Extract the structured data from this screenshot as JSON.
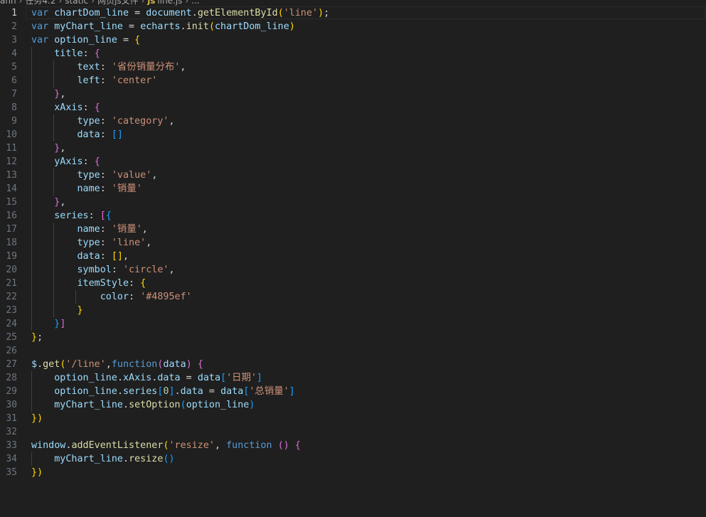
{
  "breadcrumb": {
    "items": [
      "ann",
      "任务4.2",
      "static",
      "网页js文件",
      "line.js",
      "..."
    ]
  },
  "editor": {
    "active_line": 1,
    "lines": [
      [
        [
          "kw",
          "var"
        ],
        [
          "pc",
          " "
        ],
        [
          "vr",
          "chartDom_line"
        ],
        [
          "pc",
          " = "
        ],
        [
          "vr",
          "document"
        ],
        [
          "pc",
          "."
        ],
        [
          "fn",
          "getElementById"
        ],
        [
          "b1",
          "("
        ],
        [
          "st",
          "'line'"
        ],
        [
          "b1",
          ")"
        ],
        [
          "pc",
          ";"
        ]
      ],
      [
        [
          "kw",
          "var"
        ],
        [
          "pc",
          " "
        ],
        [
          "vr",
          "myChart_line"
        ],
        [
          "pc",
          " = "
        ],
        [
          "vr",
          "echarts"
        ],
        [
          "pc",
          "."
        ],
        [
          "fn",
          "init"
        ],
        [
          "b1",
          "("
        ],
        [
          "vr",
          "chartDom_line"
        ],
        [
          "b1",
          ")"
        ]
      ],
      [
        [
          "kw",
          "var"
        ],
        [
          "pc",
          " "
        ],
        [
          "vr",
          "option_line"
        ],
        [
          "pc",
          " = "
        ],
        [
          "b1",
          "{"
        ]
      ],
      [
        [
          "pc",
          "    "
        ],
        [
          "vr",
          "title"
        ],
        [
          "pc",
          ": "
        ],
        [
          "b2",
          "{"
        ]
      ],
      [
        [
          "pc",
          "        "
        ],
        [
          "vr",
          "text"
        ],
        [
          "pc",
          ": "
        ],
        [
          "st",
          "'省份销量分布'"
        ],
        [
          "pc",
          ","
        ]
      ],
      [
        [
          "pc",
          "        "
        ],
        [
          "vr",
          "left"
        ],
        [
          "pc",
          ": "
        ],
        [
          "st",
          "'center'"
        ]
      ],
      [
        [
          "pc",
          "    "
        ],
        [
          "b2",
          "}"
        ],
        [
          "pc",
          ","
        ]
      ],
      [
        [
          "pc",
          "    "
        ],
        [
          "vr",
          "xAxis"
        ],
        [
          "pc",
          ": "
        ],
        [
          "b2",
          "{"
        ]
      ],
      [
        [
          "pc",
          "        "
        ],
        [
          "vr",
          "type"
        ],
        [
          "pc",
          ": "
        ],
        [
          "st",
          "'category'"
        ],
        [
          "pc",
          ","
        ]
      ],
      [
        [
          "pc",
          "        "
        ],
        [
          "vr",
          "data"
        ],
        [
          "pc",
          ": "
        ],
        [
          "b3",
          "[]"
        ]
      ],
      [
        [
          "pc",
          "    "
        ],
        [
          "b2",
          "}"
        ],
        [
          "pc",
          ","
        ]
      ],
      [
        [
          "pc",
          "    "
        ],
        [
          "vr",
          "yAxis"
        ],
        [
          "pc",
          ": "
        ],
        [
          "b2",
          "{"
        ]
      ],
      [
        [
          "pc",
          "        "
        ],
        [
          "vr",
          "type"
        ],
        [
          "pc",
          ": "
        ],
        [
          "st",
          "'value'"
        ],
        [
          "pc",
          ","
        ]
      ],
      [
        [
          "pc",
          "        "
        ],
        [
          "vr",
          "name"
        ],
        [
          "pc",
          ": "
        ],
        [
          "st",
          "'销量'"
        ]
      ],
      [
        [
          "pc",
          "    "
        ],
        [
          "b2",
          "}"
        ],
        [
          "pc",
          ","
        ]
      ],
      [
        [
          "pc",
          "    "
        ],
        [
          "vr",
          "series"
        ],
        [
          "pc",
          ": "
        ],
        [
          "b2",
          "["
        ],
        [
          "b3",
          "{"
        ]
      ],
      [
        [
          "pc",
          "        "
        ],
        [
          "vr",
          "name"
        ],
        [
          "pc",
          ": "
        ],
        [
          "st",
          "'销量'"
        ],
        [
          "pc",
          ","
        ]
      ],
      [
        [
          "pc",
          "        "
        ],
        [
          "vr",
          "type"
        ],
        [
          "pc",
          ": "
        ],
        [
          "st",
          "'line'"
        ],
        [
          "pc",
          ","
        ]
      ],
      [
        [
          "pc",
          "        "
        ],
        [
          "vr",
          "data"
        ],
        [
          "pc",
          ": "
        ],
        [
          "b1",
          "[]"
        ],
        [
          "pc",
          ","
        ]
      ],
      [
        [
          "pc",
          "        "
        ],
        [
          "vr",
          "symbol"
        ],
        [
          "pc",
          ": "
        ],
        [
          "st",
          "'circle'"
        ],
        [
          "pc",
          ","
        ]
      ],
      [
        [
          "pc",
          "        "
        ],
        [
          "vr",
          "itemStyle"
        ],
        [
          "pc",
          ": "
        ],
        [
          "b1",
          "{"
        ]
      ],
      [
        [
          "pc",
          "            "
        ],
        [
          "vr",
          "color"
        ],
        [
          "pc",
          ": "
        ],
        [
          "st",
          "'#4895ef'"
        ]
      ],
      [
        [
          "pc",
          "        "
        ],
        [
          "b1",
          "}"
        ]
      ],
      [
        [
          "pc",
          "    "
        ],
        [
          "b3",
          "}"
        ],
        [
          "b2",
          "]"
        ]
      ],
      [
        [
          "b1",
          "}"
        ],
        [
          "pc",
          ";"
        ]
      ],
      [],
      [
        [
          "vr",
          "$"
        ],
        [
          "pc",
          "."
        ],
        [
          "fn",
          "get"
        ],
        [
          "b1",
          "("
        ],
        [
          "st",
          "'/line'"
        ],
        [
          "pc",
          ","
        ],
        [
          "kw",
          "function"
        ],
        [
          "b2",
          "("
        ],
        [
          "vr",
          "data"
        ],
        [
          "b2",
          ")"
        ],
        [
          "pc",
          " "
        ],
        [
          "b2",
          "{"
        ]
      ],
      [
        [
          "pc",
          "    "
        ],
        [
          "vr",
          "option_line"
        ],
        [
          "pc",
          "."
        ],
        [
          "vr",
          "xAxis"
        ],
        [
          "pc",
          "."
        ],
        [
          "vr",
          "data"
        ],
        [
          "pc",
          " = "
        ],
        [
          "vr",
          "data"
        ],
        [
          "b3",
          "["
        ],
        [
          "st",
          "'日期'"
        ],
        [
          "b3",
          "]"
        ]
      ],
      [
        [
          "pc",
          "    "
        ],
        [
          "vr",
          "option_line"
        ],
        [
          "pc",
          "."
        ],
        [
          "vr",
          "series"
        ],
        [
          "b3",
          "["
        ],
        [
          "nu",
          "0"
        ],
        [
          "b3",
          "]"
        ],
        [
          "pc",
          "."
        ],
        [
          "vr",
          "data"
        ],
        [
          "pc",
          " = "
        ],
        [
          "vr",
          "data"
        ],
        [
          "b3",
          "["
        ],
        [
          "st",
          "'总销量'"
        ],
        [
          "b3",
          "]"
        ]
      ],
      [
        [
          "pc",
          "    "
        ],
        [
          "vr",
          "myChart_line"
        ],
        [
          "pc",
          "."
        ],
        [
          "fn",
          "setOption"
        ],
        [
          "b3",
          "("
        ],
        [
          "vr",
          "option_line"
        ],
        [
          "b3",
          ")"
        ]
      ],
      [
        [
          "b1",
          "}"
        ],
        [
          "b1",
          ")"
        ]
      ],
      [],
      [
        [
          "vr",
          "window"
        ],
        [
          "pc",
          "."
        ],
        [
          "fn",
          "addEventListener"
        ],
        [
          "b1",
          "("
        ],
        [
          "st",
          "'resize'"
        ],
        [
          "pc",
          ", "
        ],
        [
          "kw",
          "function"
        ],
        [
          "pc",
          " "
        ],
        [
          "b2",
          "()"
        ],
        [
          "pc",
          " "
        ],
        [
          "b2",
          "{"
        ]
      ],
      [
        [
          "pc",
          "    "
        ],
        [
          "vr",
          "myChart_line"
        ],
        [
          "pc",
          "."
        ],
        [
          "fn",
          "resize"
        ],
        [
          "b3",
          "()"
        ]
      ],
      [
        [
          "b1",
          "}"
        ],
        [
          "b1",
          ")"
        ]
      ]
    ]
  }
}
